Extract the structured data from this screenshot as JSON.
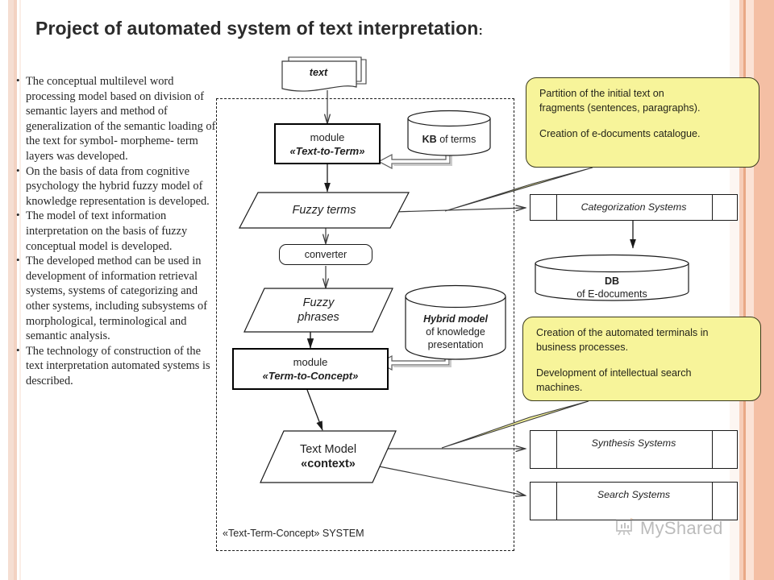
{
  "slide": {
    "title_main": "Project of automated system of text interpretation",
    "title_colon": ":"
  },
  "bullets": [
    "The conceptual multilevel word processing model based on division of semantic layers and method of generalization of the semantic loading of the text for symbol- morpheme- term layers was developed.",
    "On the basis of data from cognitive psychology the hybrid fuzzy model of knowledge representation is developed.",
    "The model of text information interpretation on the basis of fuzzy conceptual model is developed.",
    "The developed method can be used in development of information retrieval systems, systems of categorizing and other systems, including subsystems of morphological, terminological and semantic analysis.",
    "The technology of construction of the text interpretation automated systems is described."
  ],
  "diagram": {
    "system_boundary_label": "«Text-Term-Concept»  SYSTEM",
    "document_text": "text",
    "module_1": {
      "line1": "module",
      "line2": "«Text-to-Term»"
    },
    "module_2": {
      "line1": "module",
      "line2": "«Term-to-Concept»"
    },
    "kb_terms": {
      "strong": "KB",
      "rest": " of terms"
    },
    "hybrid_model": {
      "line1": "Hybrid model",
      "line2": "of knowledge",
      "line3": "presentation"
    },
    "fuzzy_terms": "Fuzzy terms",
    "converter": "converter",
    "fuzzy_phrases": {
      "line1": "Fuzzy",
      "line2": "phrases"
    },
    "text_model": {
      "line1": "Text  Model",
      "line2": "«context»"
    },
    "db_edocs": {
      "line1": "DB",
      "line2": "of E-documents"
    },
    "categorization_systems": "Categorization Systems",
    "synthesis_systems": "Synthesis Systems",
    "search_systems": "Search Systems"
  },
  "callouts": {
    "top": {
      "line1": "Partition of the initial text on",
      "line2": "fragments (sentences, paragraphs).",
      "line3": "Creation of e-documents catalogue."
    },
    "bottom": {
      "line1": "Creation of the automated terminals in",
      "line2": "business processes.",
      "line3": "Development of intellectual search",
      "line4": "machines."
    }
  },
  "watermark": {
    "label": "MyShared"
  },
  "colors": {
    "callout_fill": "#f7f49a",
    "callout_border": "#3a3a1e",
    "edge_band": "#f4bfa4",
    "ink": "#1f1f1f"
  }
}
